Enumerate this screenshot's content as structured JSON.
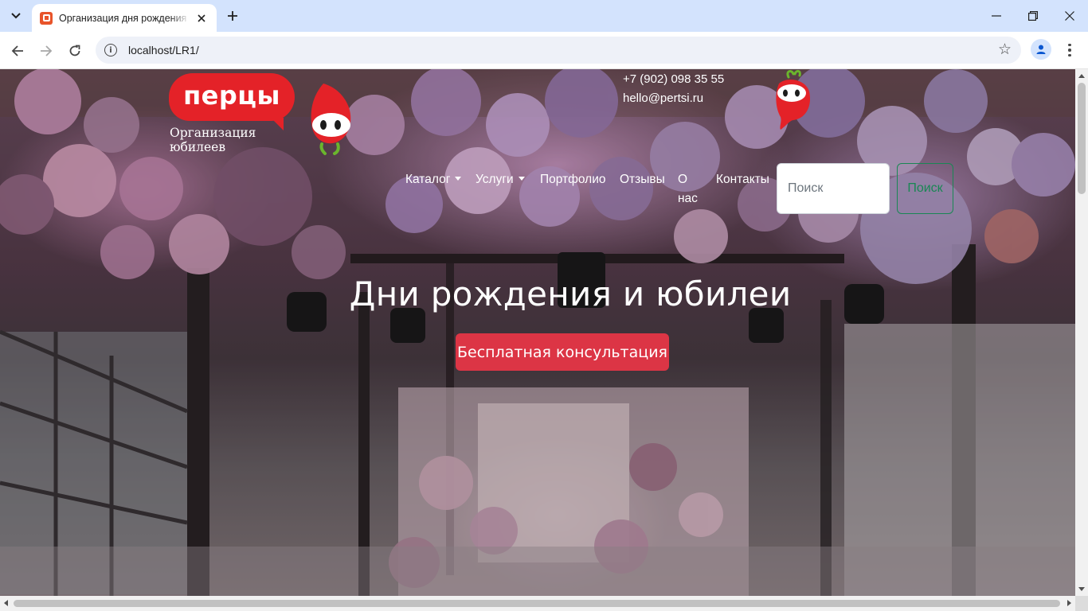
{
  "browser": {
    "tab_title": "Организация дня рождения и юбилея",
    "url": "localhost/LR1/"
  },
  "site": {
    "logo_text": "перцы",
    "tagline": "Организация юбилеев",
    "phone": "+7 (902) 098 35 55",
    "email": "hello@pertsi.ru",
    "nav": {
      "catalog": "Каталог",
      "services": "Услуги",
      "portfolio": "Портфолио",
      "reviews": "Отзывы",
      "about": "О нас",
      "contacts": "Контакты"
    },
    "search": {
      "placeholder": "Поиск",
      "button": "Поиск"
    },
    "hero": {
      "title": "Дни рождения и юбилеи",
      "cta": "Бесплатная консультация"
    },
    "colors": {
      "brand_red": "#e42228",
      "cta_red": "#dc3545",
      "search_green": "#198754"
    }
  }
}
